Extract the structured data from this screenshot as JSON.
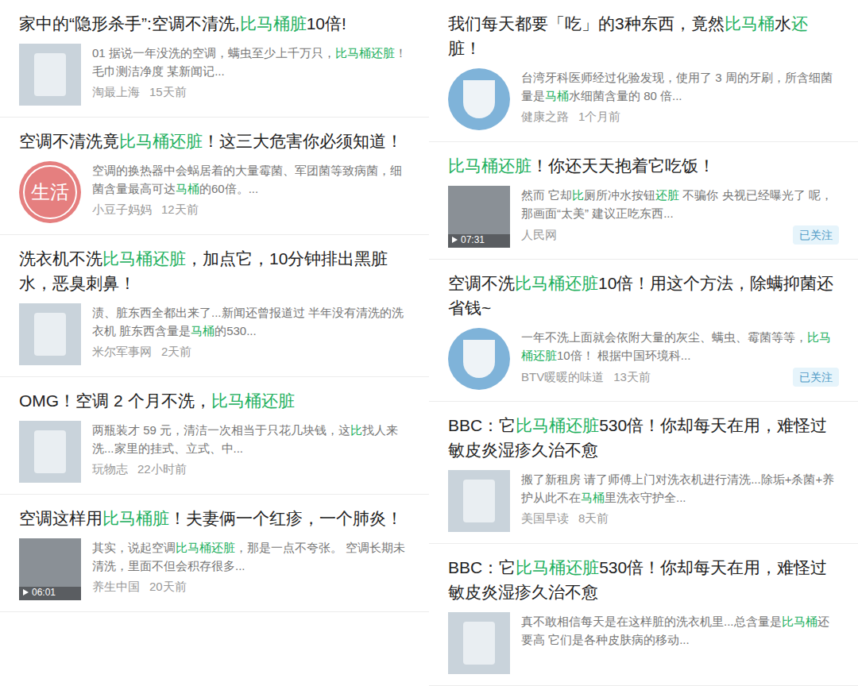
{
  "columns": [
    {
      "results": [
        {
          "title": [
            {
              "text": "家中的“隐形杀手”:空调不清洗,",
              "highlight": false
            },
            {
              "text": "比马桶脏",
              "highlight": true
            },
            {
              "text": "10倍!",
              "highlight": false
            }
          ],
          "thumbnail": {
            "kind": "photo"
          },
          "snippet": [
            {
              "text": "01 据说一年没洗的空调，螨虫至少上千万只，",
              "highlight": false
            },
            {
              "text": "比马桶还脏",
              "highlight": true
            },
            {
              "text": "！ 毛巾测洁净度 某新闻记...",
              "highlight": false
            }
          ],
          "source": "淘最上海",
          "time": "15天前"
        },
        {
          "title": [
            {
              "text": "空调不清洗竟",
              "highlight": false
            },
            {
              "text": "比马桶还脏",
              "highlight": true
            },
            {
              "text": "！这三大危害你必须知道！",
              "highlight": false
            }
          ],
          "thumbnail": {
            "kind": "logo",
            "label": "生活"
          },
          "snippet": [
            {
              "text": "空调的换热器中会蜗居着的大量霉菌、军团菌等致病菌，细菌含量最高可达",
              "highlight": false
            },
            {
              "text": "马桶",
              "highlight": true
            },
            {
              "text": "的60倍。...",
              "highlight": false
            }
          ],
          "source": "小豆子妈妈",
          "time": "12天前"
        },
        {
          "title": [
            {
              "text": "洗衣机不洗",
              "highlight": false
            },
            {
              "text": "比马桶还脏",
              "highlight": true
            },
            {
              "text": "，加点它，10分钟排出黑脏水，恶臭刺鼻！",
              "highlight": false
            }
          ],
          "thumbnail": {
            "kind": "photo"
          },
          "snippet": [
            {
              "text": "渍、脏东西全都出来了...新闻还曾报道过 半年没有清洗的洗衣机 脏东西含量是",
              "highlight": false
            },
            {
              "text": "马桶",
              "highlight": true
            },
            {
              "text": "的530...",
              "highlight": false
            }
          ],
          "source": "米尔军事网",
          "time": "2天前"
        },
        {
          "title": [
            {
              "text": "OMG！空调 2 个月不洗，",
              "highlight": false
            },
            {
              "text": "比马桶还脏",
              "highlight": true
            }
          ],
          "thumbnail": {
            "kind": "photo"
          },
          "snippet": [
            {
              "text": "两瓶装才 59 元，清洁一次相当于只花几块钱，这",
              "highlight": false
            },
            {
              "text": "比",
              "highlight": true
            },
            {
              "text": "找人来洗...家里的挂式、立式、中...",
              "highlight": false
            }
          ],
          "source": "玩物志",
          "time": "22小时前"
        },
        {
          "title": [
            {
              "text": "空调这样用",
              "highlight": false
            },
            {
              "text": "比马桶脏",
              "highlight": true
            },
            {
              "text": "！夫妻俩一个红疹，一个肺炎！",
              "highlight": false
            }
          ],
          "thumbnail": {
            "kind": "video",
            "duration": "06:01"
          },
          "snippet": [
            {
              "text": "其实，说起空调",
              "highlight": false
            },
            {
              "text": "比马桶还脏",
              "highlight": true
            },
            {
              "text": "，那是一点不夸张。 空调长期未清洗，里面不但会积存很多...",
              "highlight": false
            }
          ],
          "source": "养生中国",
          "time": "20天前"
        }
      ]
    },
    {
      "results": [
        {
          "title": [
            {
              "text": "我们每天都要「吃」的3种东西，竟然",
              "highlight": false
            },
            {
              "text": "比马桶",
              "highlight": true
            },
            {
              "text": "水",
              "highlight": false
            },
            {
              "text": "还",
              "highlight": true
            },
            {
              "text": "脏！",
              "highlight": false
            }
          ],
          "thumbnail": {
            "kind": "round"
          },
          "snippet": [
            {
              "text": "台湾牙科医师经过化验发现，使用了 3 周的牙刷，所含细菌量是",
              "highlight": false
            },
            {
              "text": "马桶",
              "highlight": true
            },
            {
              "text": "水细菌含量的 80 倍...",
              "highlight": false
            }
          ],
          "source": "健康之路",
          "time": "1个月前"
        },
        {
          "title": [
            {
              "text": "比马桶还脏",
              "highlight": true
            },
            {
              "text": "！你还天天抱着它吃饭！",
              "highlight": false
            }
          ],
          "thumbnail": {
            "kind": "video",
            "duration": "07:31"
          },
          "snippet": [
            {
              "text": "然而 它却",
              "highlight": false
            },
            {
              "text": "比",
              "highlight": true
            },
            {
              "text": "厕所冲水按钮",
              "highlight": false
            },
            {
              "text": "还脏",
              "highlight": true
            },
            {
              "text": " 不骗你 央视已经曝光了 呢，那画面“太美” 建议正吃东西...",
              "highlight": false
            }
          ],
          "source": "人民网",
          "badge": "已关注"
        },
        {
          "title": [
            {
              "text": "空调不洗",
              "highlight": false
            },
            {
              "text": "比马桶还脏",
              "highlight": true
            },
            {
              "text": "10倍！用这个方法，除螨抑菌还省钱~",
              "highlight": false
            }
          ],
          "thumbnail": {
            "kind": "round"
          },
          "snippet": [
            {
              "text": "一年不洗上面就会依附大量的灰尘、螨虫、霉菌等等，",
              "highlight": false
            },
            {
              "text": "比马桶还脏",
              "highlight": true
            },
            {
              "text": "10倍！ 根据中国环境科...",
              "highlight": false
            }
          ],
          "source": "BTV暖暖的味道",
          "time": "13天前",
          "badge": "已关注"
        },
        {
          "title": [
            {
              "text": "BBC：它",
              "highlight": false
            },
            {
              "text": "比马桶还脏",
              "highlight": true
            },
            {
              "text": "530倍！你却每天在用，难怪过敏皮炎湿疹久治不愈",
              "highlight": false
            }
          ],
          "thumbnail": {
            "kind": "photo"
          },
          "snippet": [
            {
              "text": "搬了新租房 请了师傅上门对洗衣机进行清洗...除垢+杀菌+养护从此不在",
              "highlight": false
            },
            {
              "text": "马桶",
              "highlight": true
            },
            {
              "text": "里洗衣守护全...",
              "highlight": false
            }
          ],
          "source": "美国早读",
          "time": "8天前"
        },
        {
          "title": [
            {
              "text": "BBC：它",
              "highlight": false
            },
            {
              "text": "比马桶还脏",
              "highlight": true
            },
            {
              "text": "530倍！你却每天在用，难怪过敏皮炎湿疹久治不愈",
              "highlight": false
            }
          ],
          "thumbnail": {
            "kind": "photo"
          },
          "snippet": [
            {
              "text": "真不敢相信每天是在这样脏的洗衣机里...总含量是",
              "highlight": false
            },
            {
              "text": "比马桶",
              "highlight": true
            },
            {
              "text": "还要高 它们是各种皮肤病的移动...",
              "highlight": false
            }
          ]
        }
      ]
    }
  ]
}
